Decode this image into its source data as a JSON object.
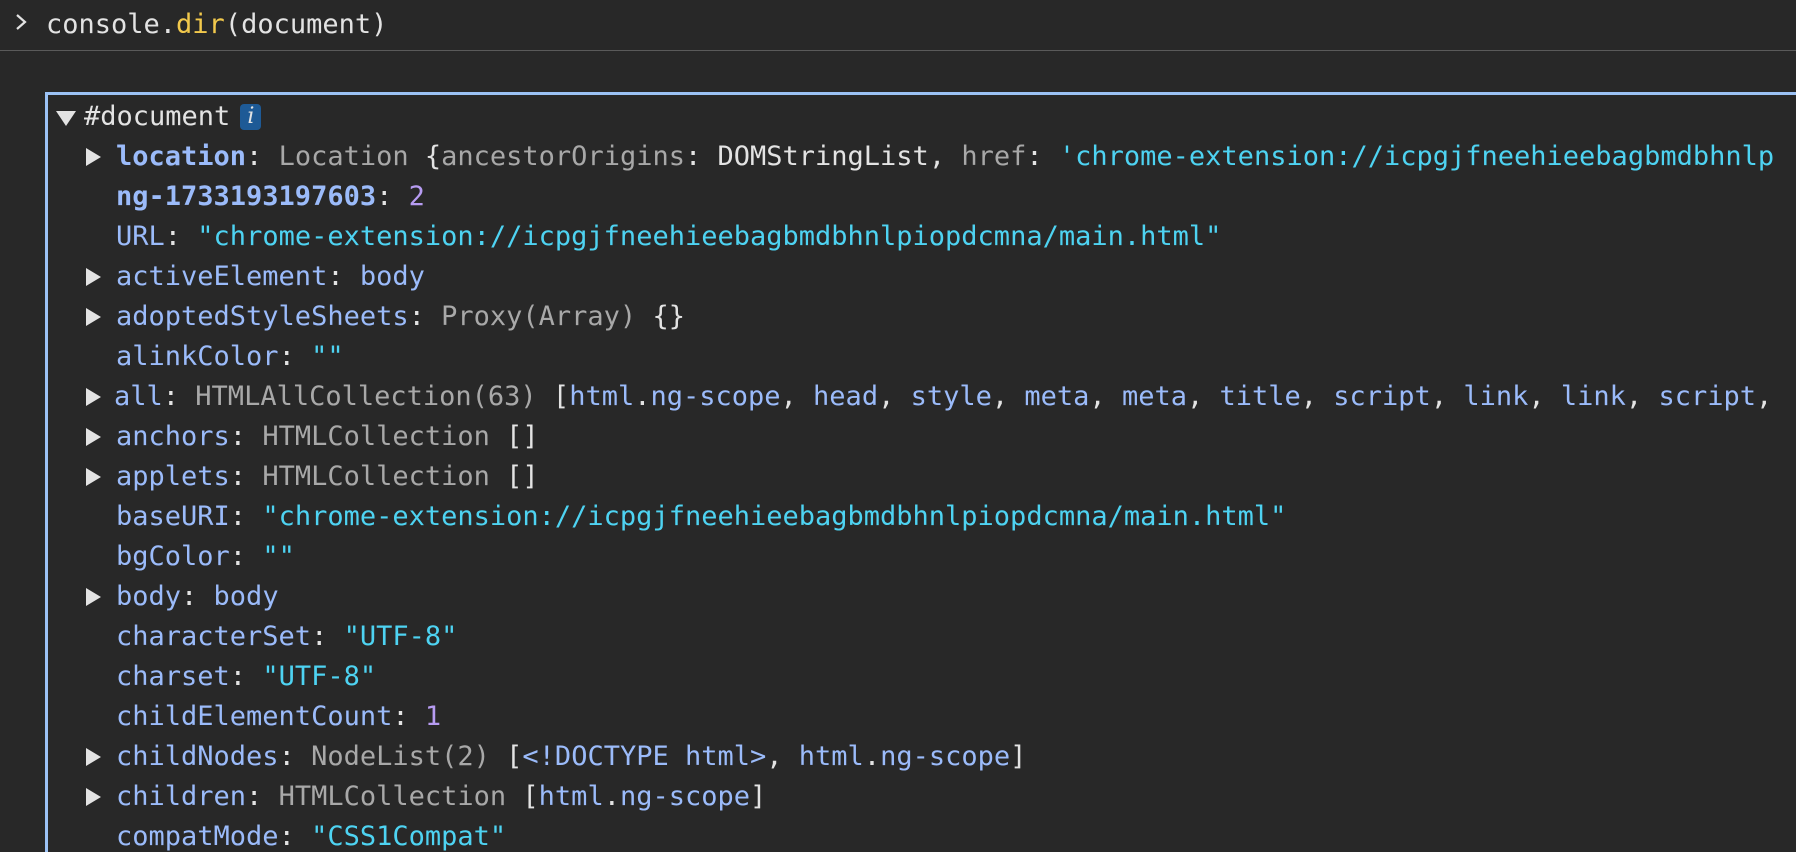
{
  "console": {
    "input": {
      "object": "console.",
      "method": "dir",
      "args": "(document)"
    }
  },
  "tree": {
    "root_label": "#document",
    "info_badge": "i",
    "entries": [
      {
        "expandable": true,
        "key": "location",
        "bold": true,
        "parts": [
          {
            "c": "t",
            "v": "Location "
          },
          {
            "c": "p",
            "v": "{"
          },
          {
            "c": "t",
            "v": "ancestorOrigins"
          },
          {
            "c": "p",
            "v": ": DOMStringList, "
          },
          {
            "c": "t",
            "v": "href"
          },
          {
            "c": "p",
            "v": ": "
          },
          {
            "c": "s",
            "v": "'chrome-extension://icpgjfneehieebagbmdbhnlp"
          }
        ]
      },
      {
        "expandable": false,
        "key": "ng-1733193197603",
        "bold": true,
        "parts": [
          {
            "c": "n",
            "v": "2"
          }
        ]
      },
      {
        "expandable": false,
        "key": "URL",
        "bold": false,
        "parts": [
          {
            "c": "s",
            "v": "\"chrome-extension://icpgjfneehieebagbmdbhnlpiopdcmna/main.html\""
          }
        ]
      },
      {
        "expandable": true,
        "key": "activeElement",
        "bold": false,
        "parts": [
          {
            "c": "ref",
            "v": "body"
          }
        ]
      },
      {
        "expandable": true,
        "key": "adoptedStyleSheets",
        "bold": false,
        "parts": [
          {
            "c": "t",
            "v": "Proxy(Array) "
          },
          {
            "c": "p",
            "v": "{}"
          }
        ]
      },
      {
        "expandable": false,
        "key": "alinkColor",
        "bold": false,
        "parts": [
          {
            "c": "s",
            "v": "\"\""
          }
        ]
      },
      {
        "expandable": true,
        "key": "all",
        "bold": false,
        "parts": [
          {
            "c": "t",
            "v": "HTMLAllCollection(63) "
          },
          {
            "c": "p",
            "v": "["
          },
          {
            "c": "ref",
            "v": "html"
          },
          {
            "c": "p",
            "v": "."
          },
          {
            "c": "ref",
            "v": "ng-scope"
          },
          {
            "c": "p",
            "v": ", "
          },
          {
            "c": "ref",
            "v": "head"
          },
          {
            "c": "p",
            "v": ", "
          },
          {
            "c": "ref",
            "v": "style"
          },
          {
            "c": "p",
            "v": ", "
          },
          {
            "c": "ref",
            "v": "meta"
          },
          {
            "c": "p",
            "v": ", "
          },
          {
            "c": "ref",
            "v": "meta"
          },
          {
            "c": "p",
            "v": ", "
          },
          {
            "c": "ref",
            "v": "title"
          },
          {
            "c": "p",
            "v": ", "
          },
          {
            "c": "ref",
            "v": "script"
          },
          {
            "c": "p",
            "v": ", "
          },
          {
            "c": "ref",
            "v": "link"
          },
          {
            "c": "p",
            "v": ", "
          },
          {
            "c": "ref",
            "v": "link"
          },
          {
            "c": "p",
            "v": ", "
          },
          {
            "c": "ref",
            "v": "script"
          },
          {
            "c": "p",
            "v": ","
          }
        ]
      },
      {
        "expandable": true,
        "key": "anchors",
        "bold": false,
        "parts": [
          {
            "c": "t",
            "v": "HTMLCollection "
          },
          {
            "c": "p",
            "v": "[]"
          }
        ]
      },
      {
        "expandable": true,
        "key": "applets",
        "bold": false,
        "parts": [
          {
            "c": "t",
            "v": "HTMLCollection "
          },
          {
            "c": "p",
            "v": "[]"
          }
        ]
      },
      {
        "expandable": false,
        "key": "baseURI",
        "bold": false,
        "parts": [
          {
            "c": "s",
            "v": "\"chrome-extension://icpgjfneehieebagbmdbhnlpiopdcmna/main.html\""
          }
        ]
      },
      {
        "expandable": false,
        "key": "bgColor",
        "bold": false,
        "parts": [
          {
            "c": "s",
            "v": "\"\""
          }
        ]
      },
      {
        "expandable": true,
        "key": "body",
        "bold": false,
        "parts": [
          {
            "c": "ref",
            "v": "body"
          }
        ]
      },
      {
        "expandable": false,
        "key": "characterSet",
        "bold": false,
        "parts": [
          {
            "c": "s",
            "v": "\"UTF-8\""
          }
        ]
      },
      {
        "expandable": false,
        "key": "charset",
        "bold": false,
        "parts": [
          {
            "c": "s",
            "v": "\"UTF-8\""
          }
        ]
      },
      {
        "expandable": false,
        "key": "childElementCount",
        "bold": false,
        "parts": [
          {
            "c": "n",
            "v": "1"
          }
        ]
      },
      {
        "expandable": true,
        "key": "childNodes",
        "bold": false,
        "parts": [
          {
            "c": "t",
            "v": "NodeList(2) "
          },
          {
            "c": "p",
            "v": "["
          },
          {
            "c": "ref",
            "v": "<!DOCTYPE html>"
          },
          {
            "c": "p",
            "v": ", "
          },
          {
            "c": "ref",
            "v": "html"
          },
          {
            "c": "p",
            "v": "."
          },
          {
            "c": "ref",
            "v": "ng-scope"
          },
          {
            "c": "p",
            "v": "]"
          }
        ]
      },
      {
        "expandable": true,
        "key": "children",
        "bold": false,
        "parts": [
          {
            "c": "t",
            "v": "HTMLCollection "
          },
          {
            "c": "p",
            "v": "["
          },
          {
            "c": "ref",
            "v": "html"
          },
          {
            "c": "p",
            "v": "."
          },
          {
            "c": "ref",
            "v": "ng-scope"
          },
          {
            "c": "p",
            "v": "]"
          }
        ]
      },
      {
        "expandable": false,
        "key": "compatMode",
        "bold": false,
        "parts": [
          {
            "c": "s",
            "v": "\"CSS1Compat\""
          }
        ]
      }
    ]
  },
  "colors": {
    "background": "#282828",
    "key": "#9bbbfa",
    "string": "#4ed3f2",
    "number": "#b79cf2",
    "type": "#a8a8a8",
    "selection_border": "#9cc2f5",
    "method": "#f2c94c"
  }
}
